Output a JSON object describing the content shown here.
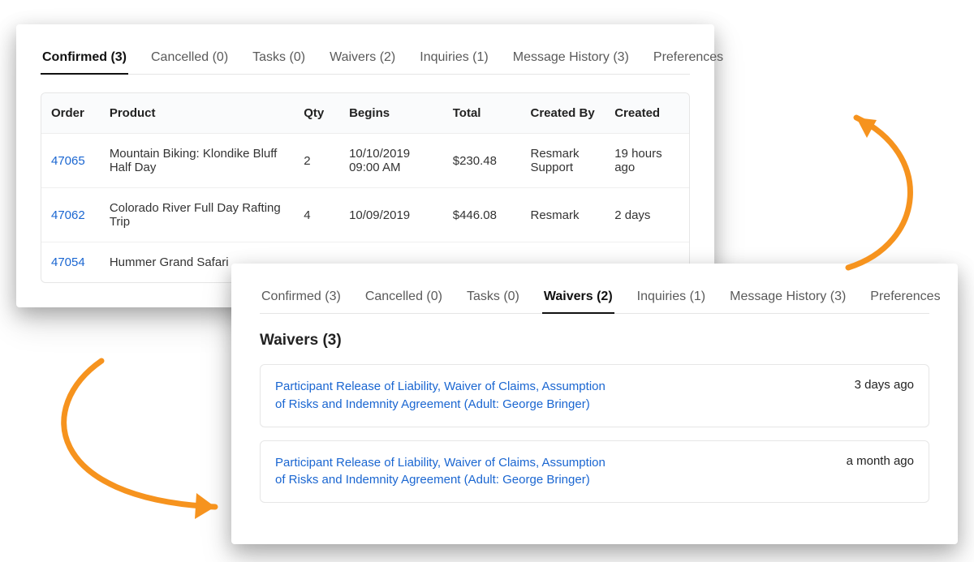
{
  "tabs": {
    "confirmed": "Confirmed (3)",
    "cancelled": "Cancelled (0)",
    "tasks": "Tasks (0)",
    "waivers": "Waivers (2)",
    "inquiries": "Inquiries (1)",
    "message_history": "Message History (3)",
    "preferences": "Preferences"
  },
  "orders_table": {
    "headers": {
      "order": "Order",
      "product": "Product",
      "qty": "Qty",
      "begins": "Begins",
      "total": "Total",
      "created_by": "Created By",
      "created": "Created"
    },
    "rows": [
      {
        "order": "47065",
        "product": "Mountain Biking: Klondike Bluff Half Day",
        "qty": "2",
        "begins": "10/10/2019 09:00 AM",
        "total": "$230.48",
        "created_by": "Resmark Support",
        "created": "19 hours ago"
      },
      {
        "order": "47062",
        "product": "Colorado River Full Day Rafting Trip",
        "qty": "4",
        "begins": "10/09/2019",
        "total": "$446.08",
        "created_by": "Resmark",
        "created": "2 days"
      },
      {
        "order": "47054",
        "product": "Hummer Grand Safari",
        "qty": "",
        "begins": "",
        "total": "",
        "created_by": "",
        "created": ""
      }
    ]
  },
  "waivers": {
    "title": "Waivers (3)",
    "items": [
      {
        "label": "Participant Release of Liability, Waiver of Claims, Assumption of Risks and Indemnity Agreement (Adult: George Bringer)",
        "time": "3 days ago"
      },
      {
        "label": "Participant Release of Liability, Waiver of Claims, Assumption of Risks and Indemnity Agreement (Adult: George Bringer)",
        "time": "a month ago"
      }
    ]
  }
}
